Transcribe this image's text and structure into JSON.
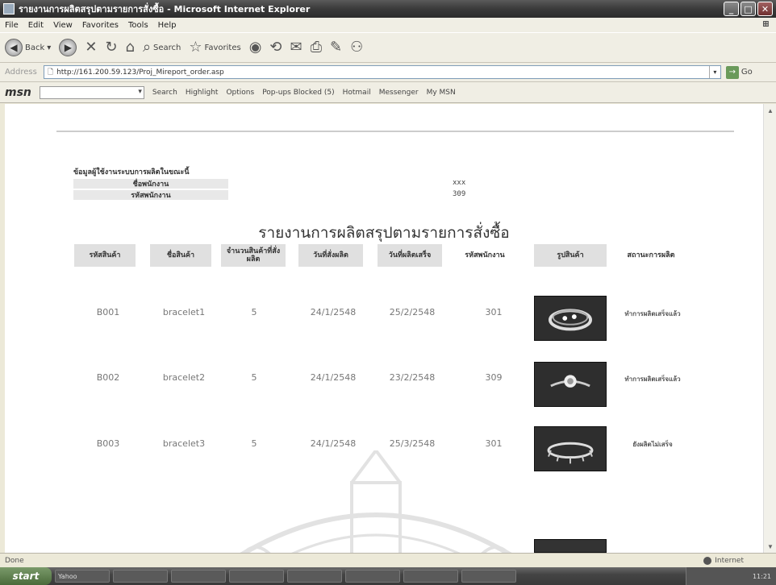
{
  "window": {
    "title": "รายงานการผลิตสรุปตามรายการสั่งซื้อ - Microsoft Internet Explorer",
    "min": "_",
    "max": "□",
    "close": "✕"
  },
  "menu": [
    "File",
    "Edit",
    "View",
    "Favorites",
    "Tools",
    "Help"
  ],
  "toolbar": {
    "back": "Back",
    "search": "Search",
    "favorites": "Favorites"
  },
  "address": {
    "label": "Address",
    "url": "http://161.200.59.123/Proj_Mireport_order.asp",
    "go": "Go"
  },
  "msnbar": {
    "logo": "msn",
    "search": "Search",
    "highlight": "Highlight",
    "options": "Options",
    "popups": "Pop-ups Blocked (5)",
    "hotmail": "Hotmail",
    "messenger": "Messenger",
    "mymsn": "My MSN"
  },
  "user_info": {
    "heading": "ข้อมูลผู้ใช้งานระบบการผลิตในขณะนี้",
    "name_label": "ชื่อพนักงาน",
    "name_value": "xxx",
    "id_label": "รหัสพนักงาน",
    "id_value": "309"
  },
  "report": {
    "title": "รายงานการผลิตสรุปตามรายการสั่งซื้อ",
    "headers": [
      "รหัสสินค้า",
      "ชื่อสินค้า",
      "จำนวนสินค้าที่สั่งผลิต",
      "วันที่สั่งผลิต",
      "วันที่ผลิตเสร็จ",
      "รหัสพนักงาน",
      "รูปสินค้า",
      "สถานะการผลิต"
    ],
    "rows": [
      {
        "code": "B001",
        "name": "bracelet1",
        "qty": "5",
        "order_date": "24/1/2548",
        "done_date": "25/2/2548",
        "emp": "301",
        "status": "ทำการผลิตเสร็จแล้ว"
      },
      {
        "code": "B002",
        "name": "bracelet2",
        "qty": "5",
        "order_date": "24/1/2548",
        "done_date": "23/2/2548",
        "emp": "309",
        "status": "ทำการผลิตเสร็จแล้ว"
      },
      {
        "code": "B003",
        "name": "bracelet3",
        "qty": "5",
        "order_date": "24/1/2548",
        "done_date": "25/3/2548",
        "emp": "301",
        "status": "ยังผลิตไม่เสร็จ"
      }
    ]
  },
  "status": {
    "left": "Done",
    "zone": "Internet"
  },
  "taskbar": {
    "start": "start",
    "items": [
      "Yahoo",
      "",
      "",
      "",
      "",
      "",
      "",
      ""
    ],
    "clock": "11:21"
  }
}
